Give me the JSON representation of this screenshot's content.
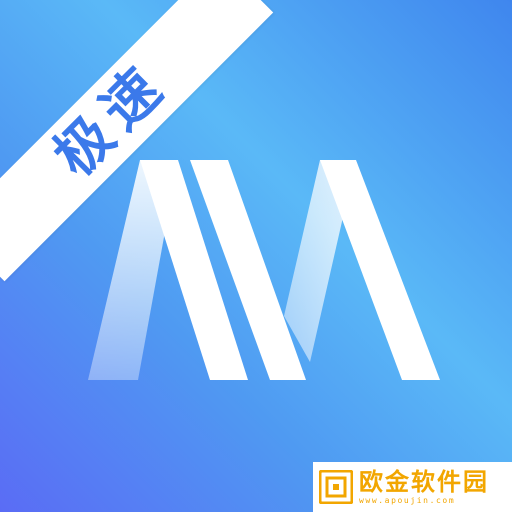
{
  "icon": {
    "badge_text": "极速",
    "logo_name": "m-monogram-icon"
  },
  "watermark": {
    "title": "欧金软件园",
    "url": "www.apoujin.com"
  },
  "colors": {
    "gradient_start": "#5a6cf5",
    "gradient_mid": "#5ab9f7",
    "gradient_end": "#3f86ee",
    "badge_text": "#3b79ea",
    "watermark_accent": "#f2a600"
  }
}
